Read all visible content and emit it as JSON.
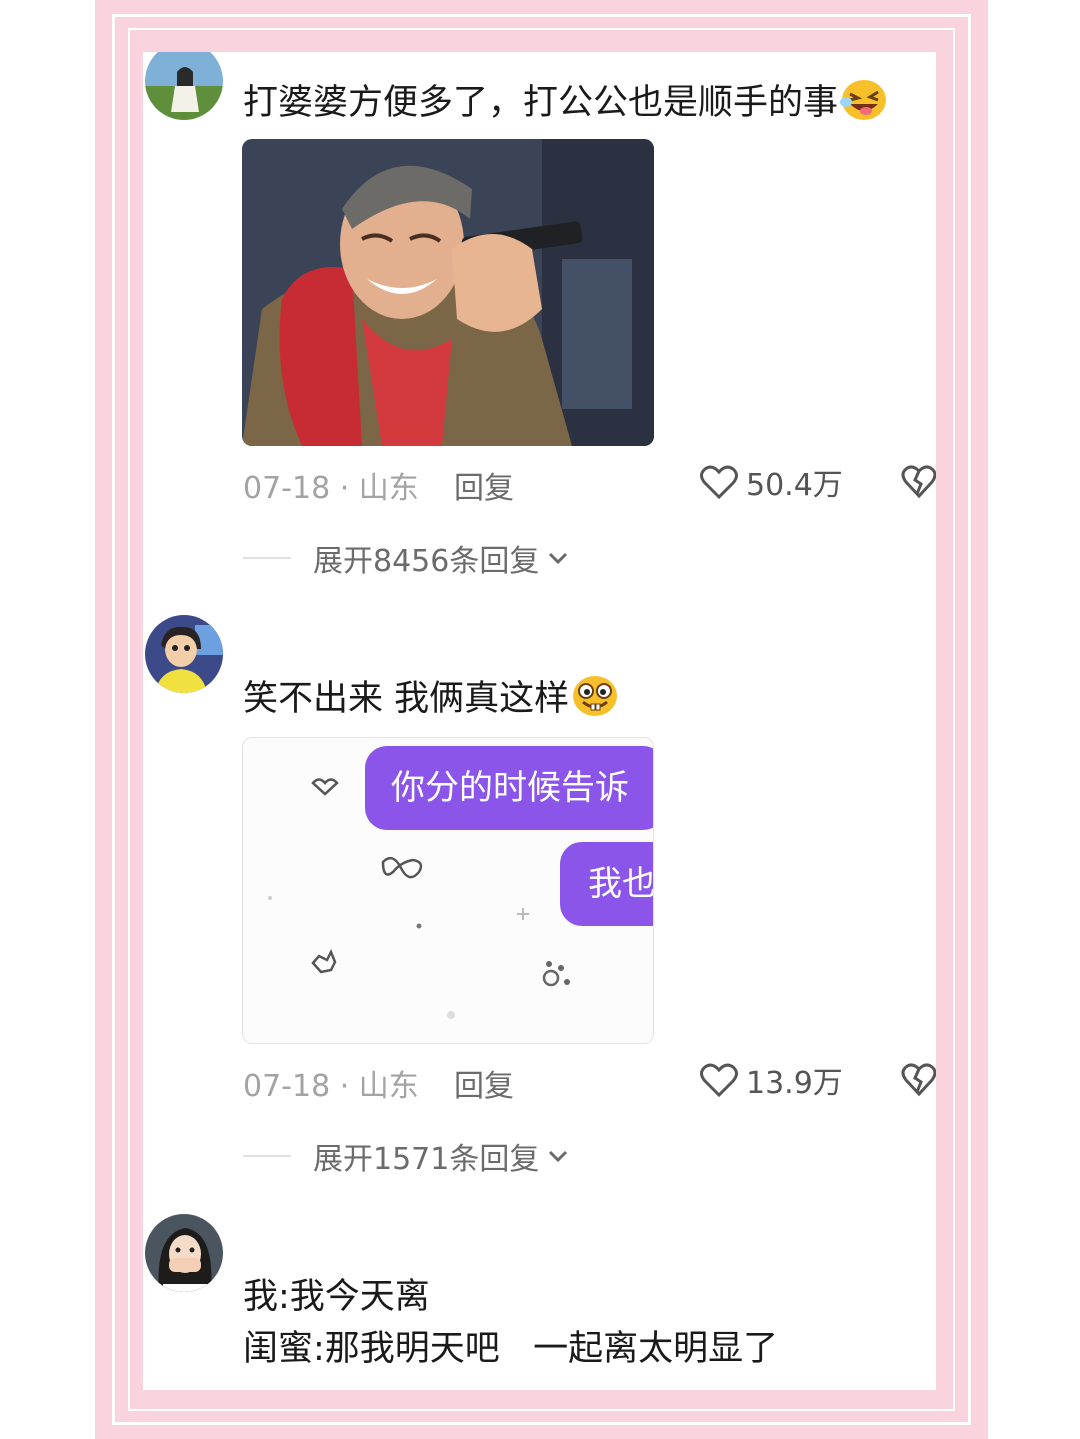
{
  "comments": [
    {
      "text": "打婆婆方便多了，打公公也是顺手的事",
      "emoji_icon": "grinning-squint-tongue-icon",
      "date_location": "07-18 · 山东",
      "reply_label": "回复",
      "likes": "50.4万",
      "expand_label": "展开8456条回复"
    },
    {
      "text": "笑不出来  我俩真这样",
      "emoji_icon": "buck-teeth-grin-icon",
      "date_location": "07-18 · 山东",
      "reply_label": "回复",
      "likes": "13.9万",
      "expand_label": "展开1571条回复",
      "chat_bubbles": [
        "你分的时候告诉",
        "我也"
      ]
    },
    {
      "line1": "我:我今天离",
      "line2": "闺蜜:那我明天吧   一起离太明显了"
    }
  ],
  "colors": {
    "frame_pink": "#f9d3de",
    "bubble_purple": "#8a55e8",
    "text": "#1a1a1a",
    "meta": "#a3a3a3"
  }
}
